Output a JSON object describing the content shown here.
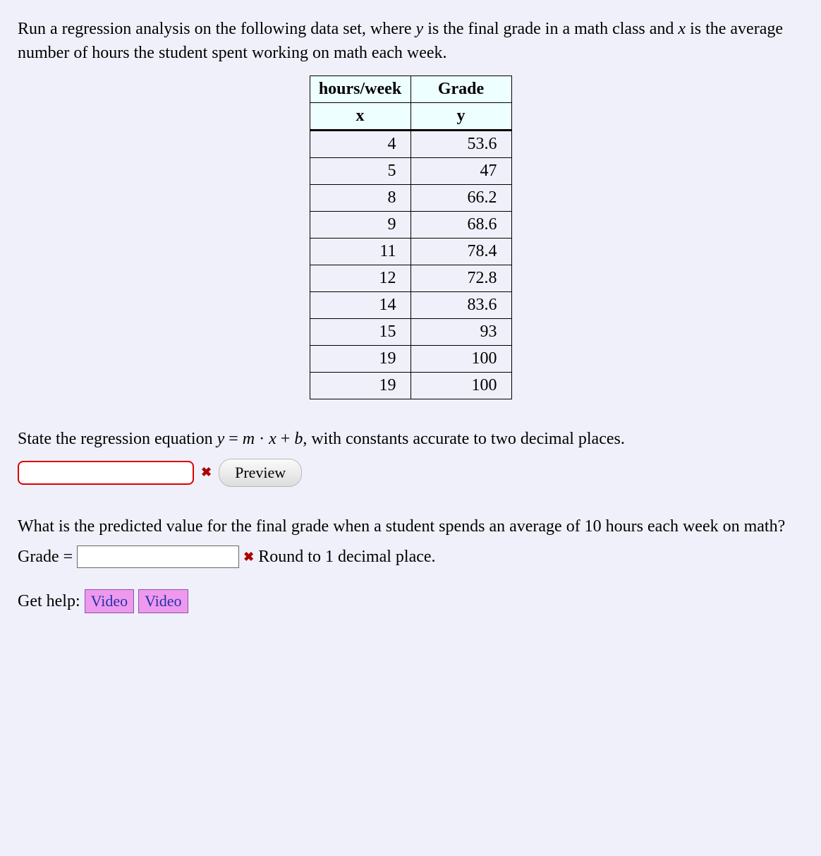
{
  "prompt": {
    "text_before_y": "Run a regression analysis on the following data set, where ",
    "y_var": "y",
    "text_mid": " is the final grade in a math class and ",
    "x_var": "x",
    "text_after_x": " is the average number of hours the student spent working on math each week."
  },
  "table": {
    "header1_col1": "hours/week",
    "header1_col2": "Grade",
    "header2_col1": "x",
    "header2_col2": "y",
    "rows": [
      {
        "x": "4",
        "y": "53.6"
      },
      {
        "x": "5",
        "y": "47"
      },
      {
        "x": "8",
        "y": "66.2"
      },
      {
        "x": "9",
        "y": "68.6"
      },
      {
        "x": "11",
        "y": "78.4"
      },
      {
        "x": "12",
        "y": "72.8"
      },
      {
        "x": "14",
        "y": "83.6"
      },
      {
        "x": "15",
        "y": "93"
      },
      {
        "x": "19",
        "y": "100"
      },
      {
        "x": "19",
        "y": "100"
      }
    ]
  },
  "q1": {
    "text_before": "State the regression equation ",
    "equation": "y = m · x + b",
    "text_after": ", with constants accurate to two decimal places."
  },
  "preview_label": "Preview",
  "q2": {
    "text": "What is the predicted value for the final grade when a student spends an average of 10 hours each week on math?",
    "grade_label": "Grade = ",
    "round_text": " Round to 1 decimal place."
  },
  "help": {
    "label": "Get help: ",
    "video1": "Video",
    "video2": "Video"
  },
  "x_mark": "✖"
}
